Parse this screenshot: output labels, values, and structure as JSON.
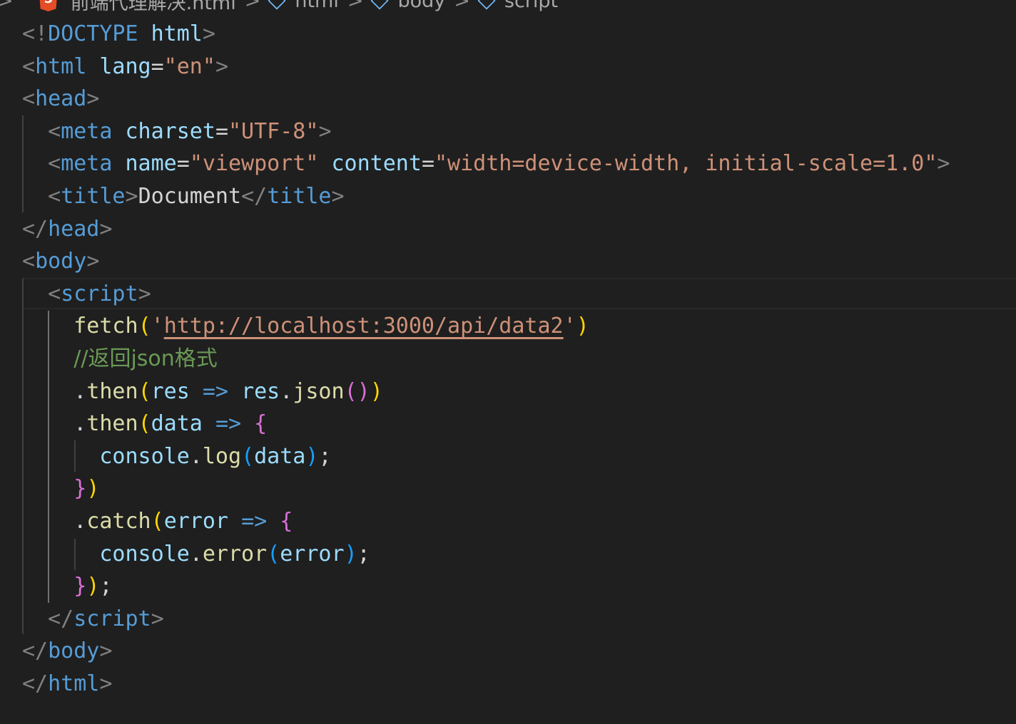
{
  "breadcrumb": {
    "file": "前端代理解决.html",
    "items": [
      "html",
      "body",
      "script"
    ],
    "separator": ">"
  },
  "code": {
    "doctype_open": "<!",
    "doctype_kw": "DOCTYPE",
    "doctype_val": "html",
    "lang_attr": "lang",
    "lang_val": "\"en\"",
    "tag_html": "html",
    "tag_head": "head",
    "tag_meta": "meta",
    "tag_title": "title",
    "tag_body": "body",
    "tag_script": "script",
    "attr_charset": "charset",
    "val_charset": "\"UTF-8\"",
    "attr_name": "name",
    "val_name": "\"viewport\"",
    "attr_content": "content",
    "val_content": "\"width=device-width, initial-scale=1.0\"",
    "title_text": "Document",
    "fetch_fn": "fetch",
    "fetch_quote_open": "'",
    "fetch_url": "http://localhost:3000/api/data2",
    "fetch_quote_close": "'",
    "comment": "//返回json格式",
    "then": "then",
    "catch": "catch",
    "res": "res",
    "json": "json",
    "data": "data",
    "error": "error",
    "console": "console",
    "log": "log",
    "error_fn": "error",
    "arrow": "=>"
  },
  "colors": {
    "background": "#1f1f1f",
    "tag": "#569cd6",
    "attribute": "#9cdcfe",
    "string": "#ce9178",
    "function": "#dcdcaa",
    "comment": "#6a9955",
    "bracket_gold": "#ffd700",
    "bracket_orchid": "#da70d6",
    "bracket_blue": "#179fff"
  }
}
